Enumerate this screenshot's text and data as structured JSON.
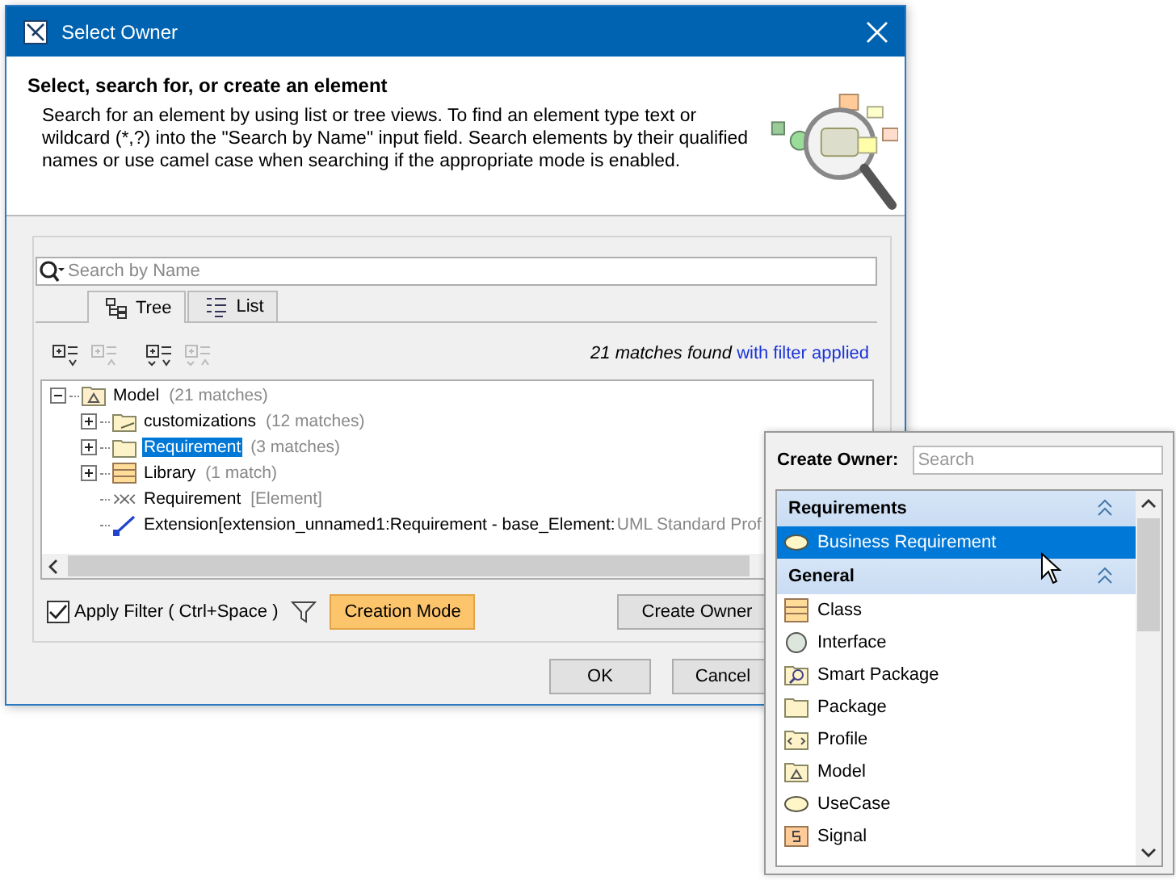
{
  "window": {
    "title": "Select Owner"
  },
  "header": {
    "title": "Select, search for, or create an element",
    "description": "Search for an element by using list or tree views. To find an element type text or wildcard (*,?) into the \"Search by Name\" input field. Search elements by their qualified names or use camel case when searching if the appropriate mode is enabled."
  },
  "search": {
    "placeholder": "Search by Name"
  },
  "tabs": [
    {
      "label": "Tree",
      "kind": "tree",
      "selected": true
    },
    {
      "label": "List",
      "kind": "list",
      "selected": false
    }
  ],
  "toolbar": [
    {
      "kind": "expand",
      "disabled": false
    },
    {
      "kind": "collapse",
      "disabled": true
    },
    {
      "kind": "expand-all",
      "disabled": false
    },
    {
      "kind": "collapse-all",
      "disabled": true
    }
  ],
  "match_info": {
    "text": "21 matches found",
    "link": "with filter applied"
  },
  "tree": [
    {
      "label": "Model",
      "note": "(21 matches)",
      "kind": "model",
      "expanded": true,
      "selected": false,
      "children": [
        {
          "label": "customizations",
          "note": "(12 matches)",
          "kind": "custom-folder",
          "expanded": false,
          "selected": false
        },
        {
          "label": "Requirement",
          "note": "(3 matches)",
          "kind": "folder",
          "expanded": false,
          "selected": true
        },
        {
          "label": "Library",
          "note": "(1 match)",
          "kind": "class",
          "expanded": false,
          "selected": false
        },
        {
          "label": "Requirement",
          "note": "[Element]",
          "kind": "stereotype",
          "selected": false
        },
        {
          "label": "Extension[extension_unnamed1:Requirement - base_Element:",
          "note": "UML Standard Prof",
          "kind": "extension",
          "selected": false
        }
      ]
    }
  ],
  "apply_filter": {
    "label": "Apply Filter ( Ctrl+Space )",
    "checked": true
  },
  "creation_mode": {
    "label": "Creation Mode",
    "on": true
  },
  "create_owner_button": "Create Owner",
  "dialog_buttons": [
    "OK",
    "Cancel"
  ],
  "popup": {
    "label": "Create Owner:",
    "search": {
      "placeholder": "Search"
    },
    "groups": [
      {
        "title": "Requirements",
        "expanded": true,
        "items": [
          {
            "label": "Business Requirement",
            "kind": "usecase",
            "selected": true
          }
        ]
      },
      {
        "title": "General",
        "expanded": true,
        "items": [
          {
            "label": "Class",
            "kind": "class",
            "selected": false
          },
          {
            "label": "Interface",
            "kind": "interface",
            "selected": false
          },
          {
            "label": "Smart Package",
            "kind": "smart-package",
            "selected": false
          },
          {
            "label": "Package",
            "kind": "folder",
            "selected": false
          },
          {
            "label": "Profile",
            "kind": "profile",
            "selected": false
          },
          {
            "label": "Model",
            "kind": "model",
            "selected": false
          },
          {
            "label": "UseCase",
            "kind": "usecase",
            "selected": false
          },
          {
            "label": "Signal",
            "kind": "signal",
            "selected": false
          }
        ]
      }
    ]
  }
}
